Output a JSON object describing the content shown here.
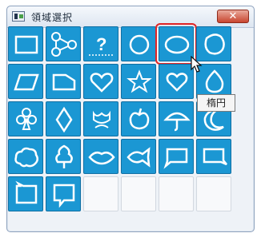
{
  "window": {
    "title": "領域選択",
    "close_label": "✕"
  },
  "tooltip": {
    "text": "楕円"
  },
  "palette": {
    "selected_icon": "ellipse-icon",
    "icons": [
      "rectangle-icon",
      "network-icon",
      "question-icon",
      "circle-icon",
      "ellipse-icon",
      "blob-icon",
      "parallelogram-icon",
      "trapezoid-icon",
      "heart-icon",
      "star-icon",
      "heart-outline-icon",
      "drop-icon",
      "club-icon",
      "diamond-icon",
      "flower-icon",
      "apple-icon",
      "umbrella-icon",
      "moon-icon",
      "cloud-icon",
      "tree-icon",
      "lips-icon",
      "fish-icon",
      "speech-bubble-icon",
      "speech-bubble-right-icon",
      "speech-bubble-left-icon",
      "speech-bubble-down-icon"
    ],
    "empty_slots": 4
  },
  "colors": {
    "accent": "#1b97d3",
    "selection": "#e02424"
  }
}
